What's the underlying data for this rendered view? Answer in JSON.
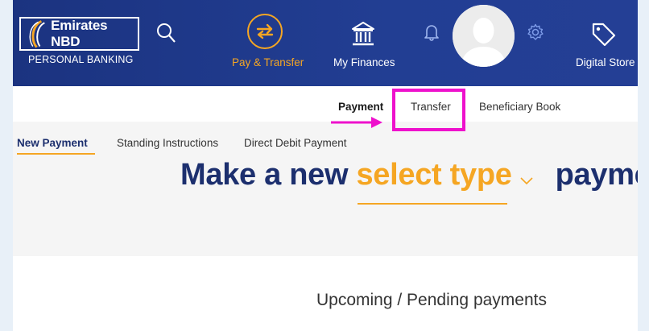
{
  "header": {
    "brand_name": "Emirates NBD",
    "brand_sub": "PERSONAL BANKING",
    "nav": {
      "pay_transfer": "Pay & Transfer",
      "my_finances": "My Finances",
      "digital_store": "Digital Store"
    },
    "icons": [
      "search-icon",
      "transfer-arrows-icon",
      "bank-icon",
      "bell-icon",
      "avatar",
      "gear-icon",
      "tag-icon"
    ],
    "accent_color": "#f5a623",
    "bar_color": "#1e3a8a"
  },
  "subnav": {
    "payment": "Payment",
    "transfer": "Transfer",
    "beneficiary_book": "Beneficiary Book",
    "highlight_color": "#ee11cc"
  },
  "tabs": {
    "new_payment": "New Payment",
    "standing_instructions": "Standing Instructions",
    "direct_debit": "Direct Debit Payment"
  },
  "main": {
    "heading_prefix": "Make a new ",
    "heading_select": "select type",
    "heading_suffix": "payme",
    "upcoming_title": "Upcoming / Pending payments"
  }
}
